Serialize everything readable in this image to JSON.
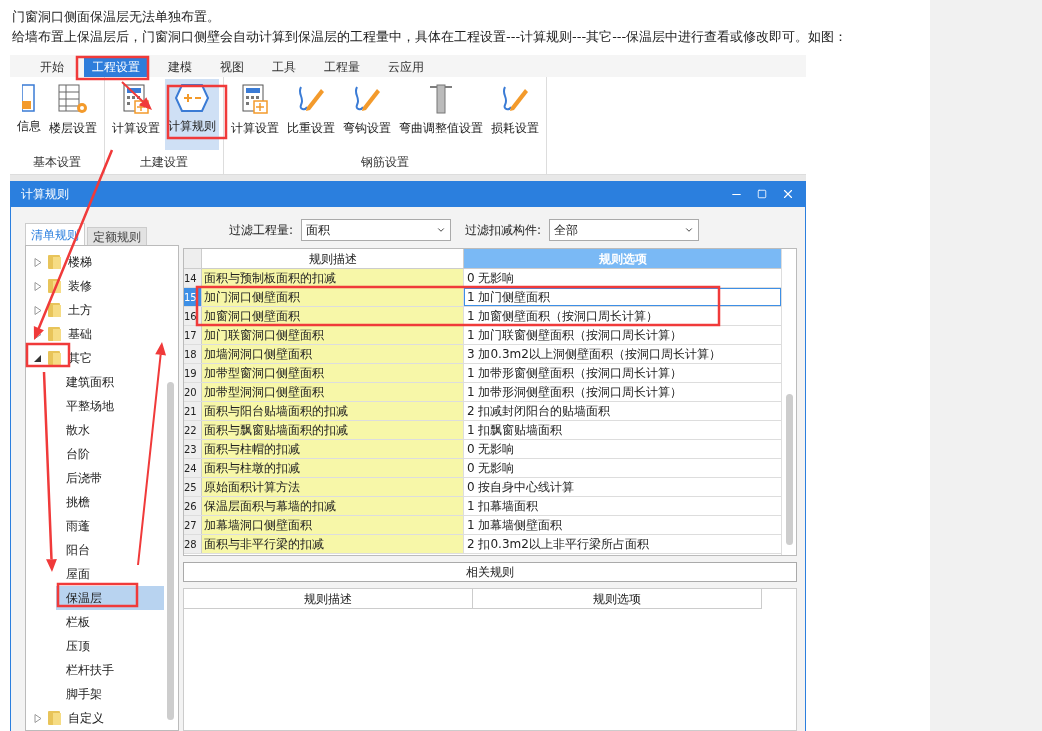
{
  "article": {
    "paragraphs": [
      "门窗洞口侧面保温层无法单独布置。",
      "给墙布置上保温层后，门窗洞口侧壁会自动计算到保温层的工程量中，具体在工程设置---计算规则---其它---保温层中进行查看或修改即可。如图："
    ]
  },
  "ribbon": {
    "tabs": [
      {
        "label": "开始",
        "selected": false
      },
      {
        "label": "工程设置",
        "selected": true
      },
      {
        "label": "建模",
        "selected": false
      },
      {
        "label": "视图",
        "selected": false
      },
      {
        "label": "工具",
        "selected": false
      },
      {
        "label": "工程量",
        "selected": false
      },
      {
        "label": "云应用",
        "selected": false
      }
    ],
    "groups": [
      {
        "label": "基本设置",
        "buttons": [
          {
            "label": "信息",
            "kind": "info",
            "selected": false
          },
          {
            "label": "楼层设置",
            "kind": "floors",
            "selected": false
          }
        ]
      },
      {
        "label": "土建设置",
        "buttons": [
          {
            "label": "计算设置",
            "kind": "calc",
            "selected": false
          },
          {
            "label": "计算规则",
            "kind": "rule",
            "selected": true
          }
        ]
      },
      {
        "label": "钢筋设置",
        "buttons": [
          {
            "label": "计算设置",
            "kind": "calc",
            "selected": false
          },
          {
            "label": "比重设置",
            "kind": "pen",
            "selected": false
          },
          {
            "label": "弯钩设置",
            "kind": "pen",
            "selected": false
          },
          {
            "label": "弯曲调整值设置",
            "kind": "bar",
            "selected": false
          },
          {
            "label": "损耗设置",
            "kind": "pen",
            "selected": false
          }
        ]
      }
    ]
  },
  "dialog": {
    "title": "计算规则",
    "tabs": [
      {
        "label": "清单规则",
        "selected": true
      },
      {
        "label": "定额规则",
        "selected": false
      }
    ],
    "filters": [
      {
        "label": "过滤工程量:",
        "value": "面积"
      },
      {
        "label": "过滤扣减构件:",
        "value": "全部"
      }
    ],
    "tree": [
      {
        "label": "楼梯",
        "expanded": false
      },
      {
        "label": "装修",
        "expanded": false
      },
      {
        "label": "土方",
        "expanded": false
      },
      {
        "label": "基础",
        "expanded": false
      },
      {
        "label": "其它",
        "expanded": true,
        "children": [
          {
            "label": "建筑面积",
            "selected": false
          },
          {
            "label": "平整场地",
            "selected": false
          },
          {
            "label": "散水",
            "selected": false
          },
          {
            "label": "台阶",
            "selected": false
          },
          {
            "label": "后浇带",
            "selected": false
          },
          {
            "label": "挑檐",
            "selected": false
          },
          {
            "label": "雨蓬",
            "selected": false
          },
          {
            "label": "阳台",
            "selected": false
          },
          {
            "label": "屋面",
            "selected": false
          },
          {
            "label": "保温层",
            "selected": true
          },
          {
            "label": "栏板",
            "selected": false
          },
          {
            "label": "压顶",
            "selected": false
          },
          {
            "label": "栏杆扶手",
            "selected": false
          },
          {
            "label": "脚手架",
            "selected": false
          }
        ]
      },
      {
        "label": "自定义",
        "expanded": false
      }
    ],
    "table": {
      "columns": [
        "规则描述",
        "规则选项"
      ],
      "rows": [
        {
          "number": "14",
          "description": "面积与预制板面积的扣减",
          "option": "0  无影响",
          "selected": false
        },
        {
          "number": "15",
          "description": "加门洞口侧壁面积",
          "option": "1 加门侧壁面积",
          "selected": true
        },
        {
          "number": "16",
          "description": "加窗洞口侧壁面积",
          "option": "1 加窗侧壁面积（按洞口周长计算）",
          "selected": false
        },
        {
          "number": "17",
          "description": "加门联窗洞口侧壁面积",
          "option": "1 加门联窗侧壁面积（按洞口周长计算）",
          "selected": false
        },
        {
          "number": "18",
          "description": "加墙洞洞口侧壁面积",
          "option": "3 加0.3m2以上洞侧壁面积（按洞口周长计算）",
          "selected": false
        },
        {
          "number": "19",
          "description": "加带型窗洞口侧壁面积",
          "option": "1 加带形窗侧壁面积（按洞口周长计算）",
          "selected": false
        },
        {
          "number": "20",
          "description": "加带型洞洞口侧壁面积",
          "option": "1 加带形洞侧壁面积（按洞口周长计算）",
          "selected": false
        },
        {
          "number": "21",
          "description": "面积与阳台贴墙面积的扣减",
          "option": "2 扣减封闭阳台的贴墙面积",
          "selected": false
        },
        {
          "number": "22",
          "description": "面积与飘窗贴墙面积的扣减",
          "option": "1 扣飘窗贴墙面积",
          "selected": false
        },
        {
          "number": "23",
          "description": "面积与柱帽的扣减",
          "option": "0  无影响",
          "selected": false
        },
        {
          "number": "24",
          "description": "面积与柱墩的扣减",
          "option": "0  无影响",
          "selected": false
        },
        {
          "number": "25",
          "description": "原始面积计算方法",
          "option": "0 按自身中心线计算",
          "selected": false
        },
        {
          "number": "26",
          "description": "保温层面积与幕墙的扣减",
          "option": "1 扣幕墙面积",
          "selected": false
        },
        {
          "number": "27",
          "description": "加幕墙洞口侧壁面积",
          "option": "1 加幕墙侧壁面积",
          "selected": false
        },
        {
          "number": "28",
          "description": "面积与非平行梁的扣减",
          "option": "2 扣0.3m2以上非平行梁所占面积",
          "selected": false
        }
      ]
    },
    "related": {
      "title": "相关规则",
      "columns": [
        "规则描述",
        "规则选项"
      ]
    }
  }
}
